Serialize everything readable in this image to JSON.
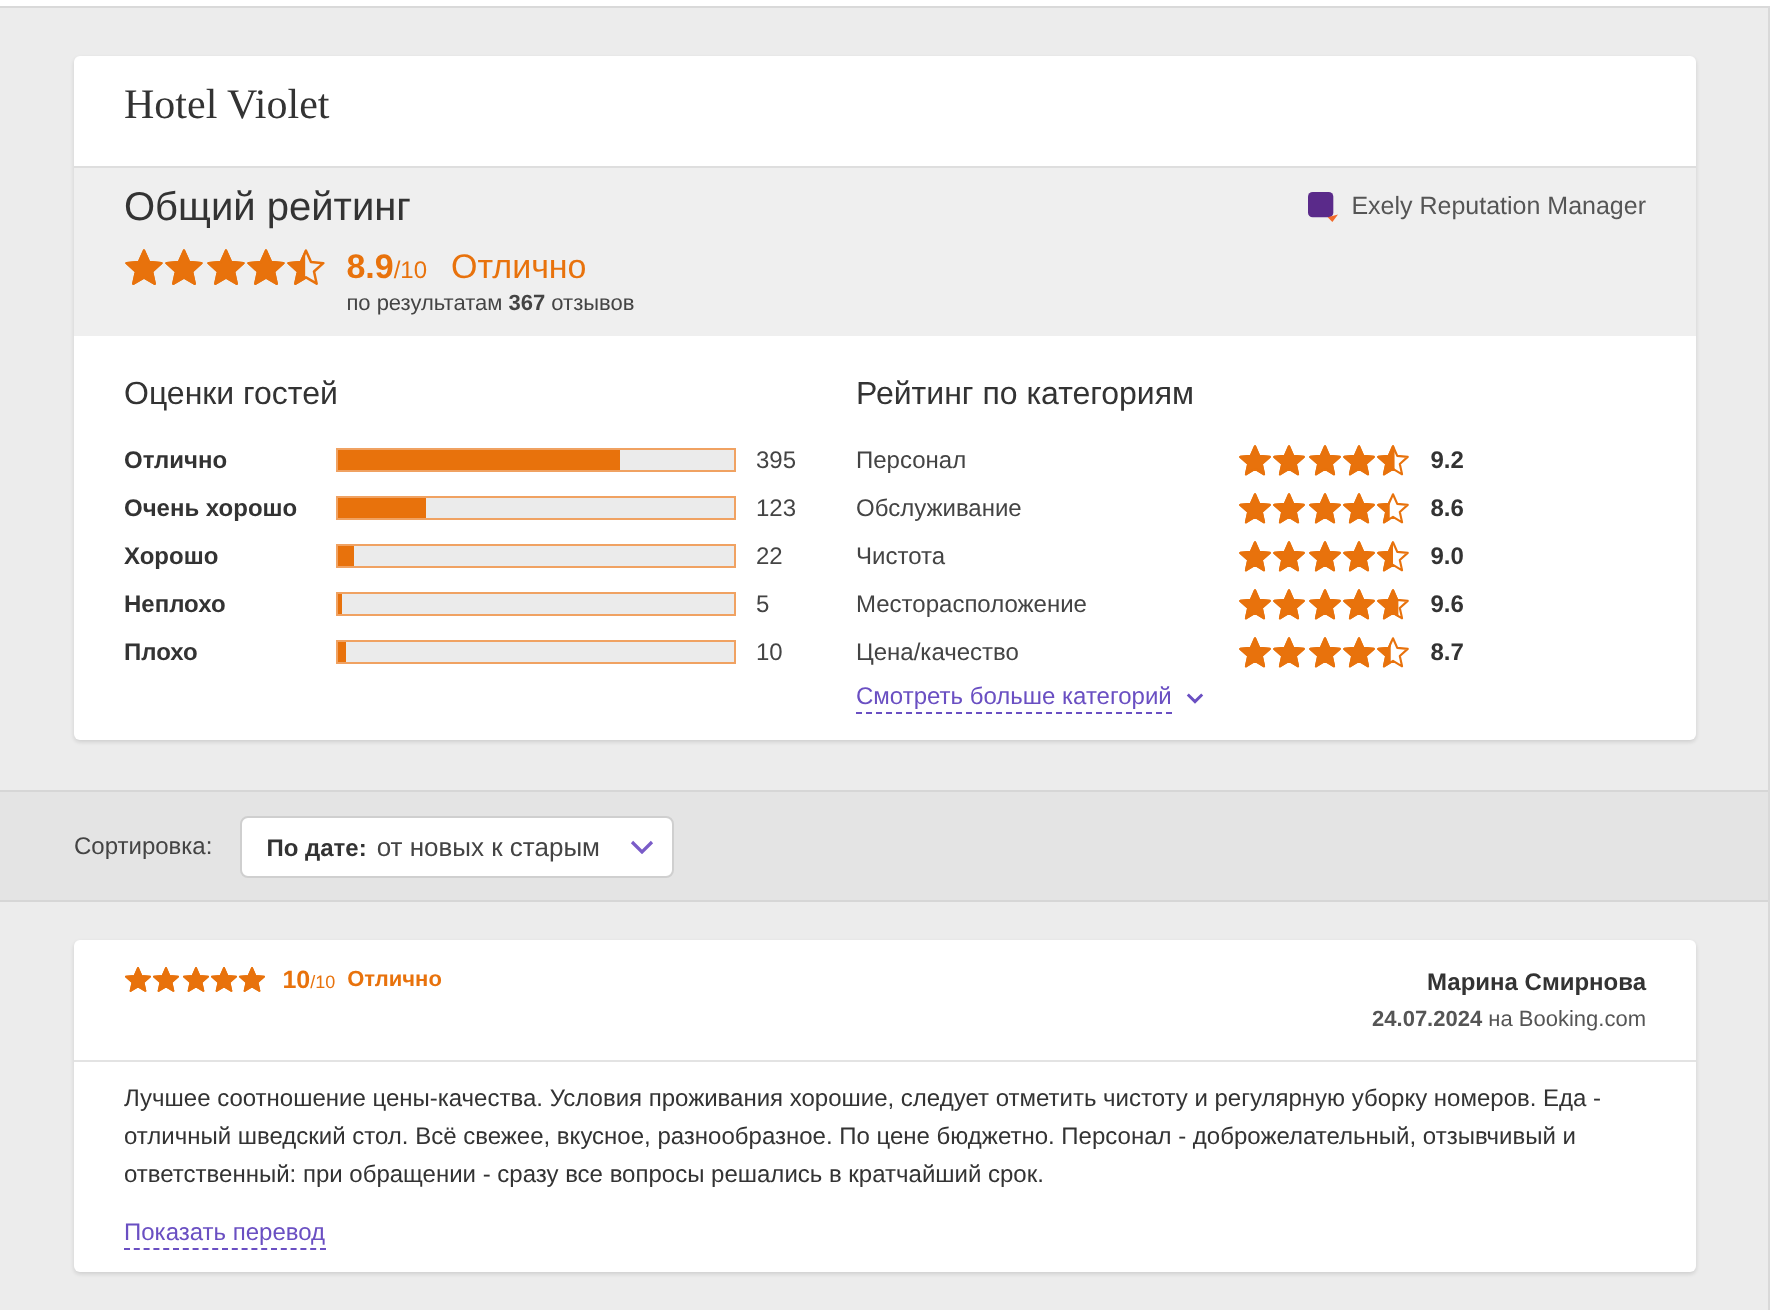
{
  "hotel": {
    "name": "Hotel Violet"
  },
  "overall": {
    "title": "Общий рейтинг",
    "stars": 4.45,
    "score": "8.9",
    "scale": "/10",
    "verdict": "Отлично",
    "summary": "по результатам **367** отзывов",
    "provider": "Exely Reputation Manager"
  },
  "guest_ratings": {
    "title": "Оценки гостей",
    "rows": [
      {
        "label": "Отлично",
        "level": 0.712,
        "count": "395"
      },
      {
        "label": "Очень хорошо",
        "level": 0.222,
        "count": "123"
      },
      {
        "label": "Хорошо",
        "level": 0.04,
        "count": "22"
      },
      {
        "label": "Неплохо",
        "level": 0.009,
        "count": "5"
      },
      {
        "label": "Плохо",
        "level": 0.018,
        "count": "10"
      }
    ]
  },
  "category_ratings": {
    "title": "Рейтинг по категориям",
    "rows": [
      {
        "label": "Персонал",
        "stars": 4.6,
        "score": "9.2"
      },
      {
        "label": "Обслуживание",
        "stars": 4.3,
        "score": "8.6"
      },
      {
        "label": "Чистота",
        "stars": 4.5,
        "score": "9.0"
      },
      {
        "label": "Месторасположение",
        "stars": 4.8,
        "score": "9.6"
      },
      {
        "label": "Цена/качество",
        "stars": 4.35,
        "score": "8.7"
      }
    ],
    "more_link": "Смотреть больше категорий"
  },
  "sort": {
    "label": "Сортировка:",
    "field": "По дате:",
    "value": "от новых к старым"
  },
  "reviews": [
    {
      "stars": 5,
      "score": "10",
      "scale": "/10",
      "verdict": "Отлично",
      "author": "Марина Смирнова",
      "date_source": "**24.07.2024** на Booking.com",
      "text": "Лучшее соотношение цены-качества. Условия проживания хорошие, следует отметить чистоту и регулярную уборку номеров. Еда - отличный шведский стол. Всё свежее, вкусное, разнообразное. По цене бюджетно. Персонал - доброжелательный, отзывчивый и ответственный: при обращении - сразу все вопросы решались в кратчайший срок.",
      "translate_link": "Показать перевод"
    }
  ]
}
